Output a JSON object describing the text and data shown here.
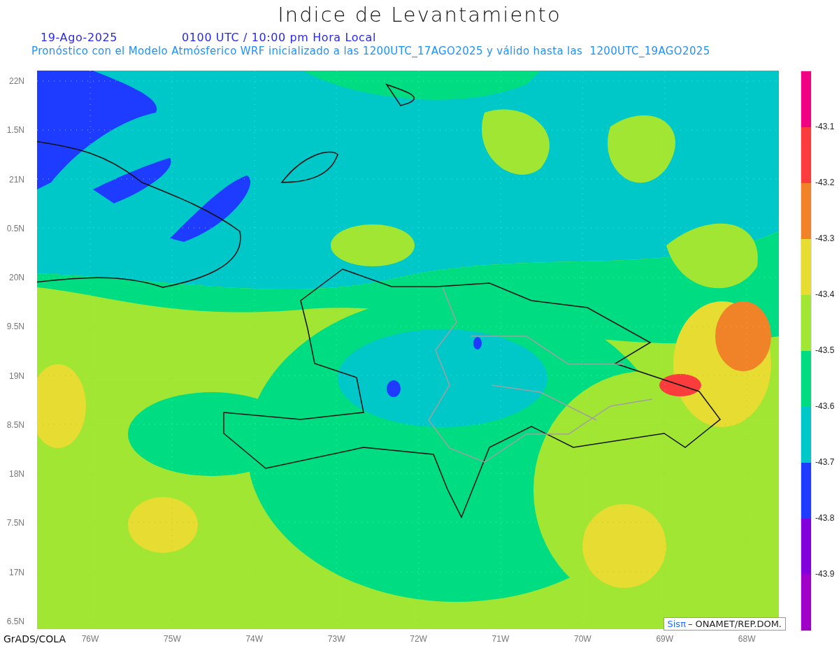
{
  "title": "Indice de Levantamiento",
  "date": "19-Ago-2025",
  "time": "0100 UTC / 10:00 pm Hora Local",
  "subtitle": "Pronóstico con el Modelo Atmósferico WRF inicializado a las 1200UTC_17AGO2025 y válido hasta las  1200UTC_19AGO2025",
  "map": {
    "latitude_labels": [
      "22N",
      "1.5N",
      "21N",
      "0.5N",
      "20N",
      "9.5N",
      "19N",
      "8.5N",
      "18N",
      "7.5N",
      "17N",
      "6.5N"
    ],
    "longitude_labels": [
      "76W",
      "75W",
      "74W",
      "73W",
      "72W",
      "71W",
      "70W",
      "69W",
      "68W"
    ]
  },
  "legend": {
    "bins": [
      {
        "color": "#f00082"
      },
      {
        "color": "#fa3c3c"
      },
      {
        "color": "#f08228"
      },
      {
        "color": "#e6dc32"
      },
      {
        "color": "#a0e632"
      },
      {
        "color": "#00dc82"
      },
      {
        "color": "#00c8c8"
      },
      {
        "color": "#1e3cff"
      },
      {
        "color": "#8200dc"
      },
      {
        "color": "#a000c8"
      }
    ],
    "labels": [
      "-43.1",
      "-43.2",
      "-43.3",
      "-43.4",
      "-43.5",
      "-43.6",
      "-43.7",
      "-43.8",
      "-43.9"
    ]
  },
  "credit": {
    "brand": "Sisπ",
    "text": "– ONAMET/REP.DOM."
  },
  "footer": "GrADS/COLA"
}
